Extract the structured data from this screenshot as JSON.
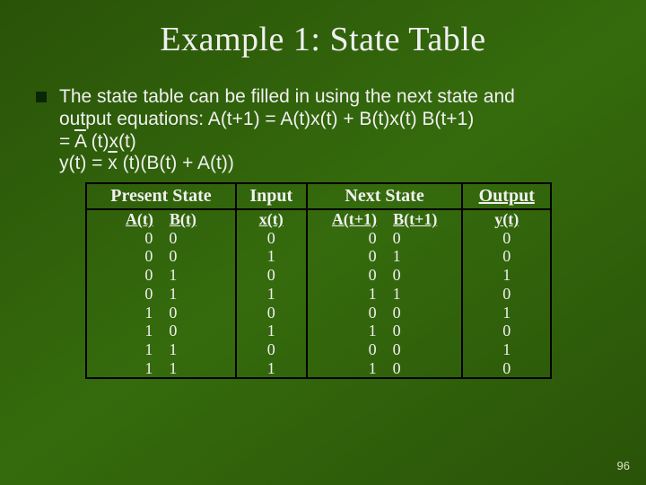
{
  "title": "Example 1: State Table",
  "body": {
    "line1": "The state table can be filled in using the next state and",
    "line2a": "output equations: A(t+1) = A(t)x(t) + B(t)x(t) B(t+1)",
    "line2b_pre": "= ",
    "line2b_bar": "A",
    "line2b_post": " (t)x(t)",
    "line3_pre": "y(t) = ",
    "line3_bar": "x",
    "line3_post": " (t)(B(t) + A(t))"
  },
  "table": {
    "groups": [
      "Present State",
      "Input",
      "Next State",
      "Output"
    ],
    "subheaders": {
      "ps_a": "A(t)",
      "ps_b": "B(t)",
      "inp": "x(t)",
      "ns_a": "A(t+1)",
      "ns_b": "B(t+1)",
      "out": "y(t)"
    },
    "rows": [
      {
        "a": "0",
        "b": "0",
        "x": "0",
        "na": "0",
        "nb": "0",
        "y": "0"
      },
      {
        "a": "0",
        "b": "0",
        "x": "1",
        "na": "0",
        "nb": "1",
        "y": "0"
      },
      {
        "a": "0",
        "b": "1",
        "x": "0",
        "na": "0",
        "nb": "0",
        "y": "1"
      },
      {
        "a": "0",
        "b": "1",
        "x": "1",
        "na": "1",
        "nb": "1",
        "y": "0"
      },
      {
        "a": "1",
        "b": "0",
        "x": "0",
        "na": "0",
        "nb": "0",
        "y": "1"
      },
      {
        "a": "1",
        "b": "0",
        "x": "1",
        "na": "1",
        "nb": "0",
        "y": "0"
      },
      {
        "a": "1",
        "b": "1",
        "x": "0",
        "na": "0",
        "nb": "0",
        "y": "1"
      },
      {
        "a": "1",
        "b": "1",
        "x": "1",
        "na": "1",
        "nb": "0",
        "y": "0"
      }
    ]
  },
  "page_number": "96"
}
